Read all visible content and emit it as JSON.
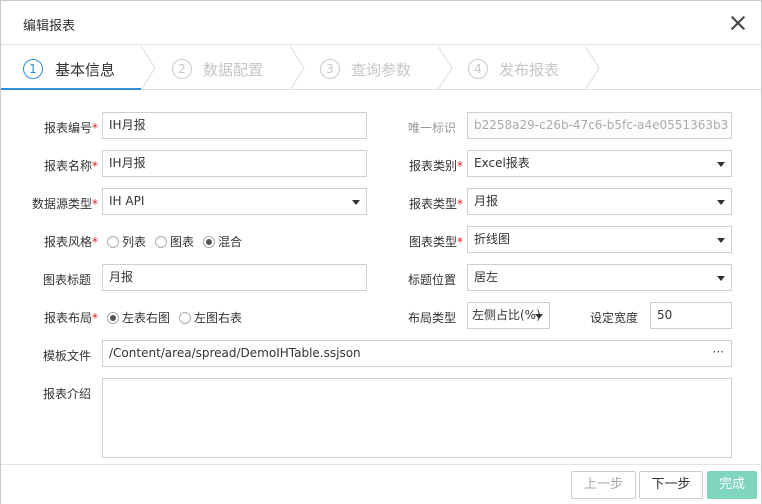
{
  "dialog": {
    "title": "编辑报表"
  },
  "steps": [
    {
      "num": "1",
      "label": "基本信息"
    },
    {
      "num": "2",
      "label": "数据配置"
    },
    {
      "num": "3",
      "label": "查询参数"
    },
    {
      "num": "4",
      "label": "发布报表"
    }
  ],
  "form": {
    "report_code": {
      "label": "报表编号",
      "value": "IH月报"
    },
    "unique_id": {
      "label": "唯一标识",
      "value": "b2258a29-c26b-47c6-b5fc-a4e0551363b3"
    },
    "report_name": {
      "label": "报表名称",
      "value": "IH月报"
    },
    "report_category": {
      "label": "报表类别",
      "value": "Excel报表"
    },
    "datasource_type": {
      "label": "数据源类型",
      "value": "IH API"
    },
    "report_type": {
      "label": "报表类型",
      "value": "月报"
    },
    "report_style": {
      "label": "报表风格",
      "options": [
        "列表",
        "图表",
        "混合"
      ],
      "selected": "混合"
    },
    "chart_type": {
      "label": "图表类型",
      "value": "折线图"
    },
    "chart_title": {
      "label": "图表标题",
      "value": "月报"
    },
    "title_position": {
      "label": "标题位置",
      "value": "居左"
    },
    "report_layout": {
      "label": "报表布局",
      "options": [
        "左表右图",
        "左图右表"
      ],
      "selected": "左表右图"
    },
    "layout_type": {
      "label": "布局类型",
      "value": "左侧占比(%)"
    },
    "set_width": {
      "label": "设定宽度",
      "value": "50"
    },
    "template_file": {
      "label": "模板文件",
      "value": "/Content/area/spread/DemoIHTable.ssjson",
      "browse": "···"
    },
    "report_intro": {
      "label": "报表介绍",
      "value": ""
    },
    "required_mark": "*"
  },
  "footer": {
    "prev": "上一步",
    "next": "下一步",
    "finish": "完成"
  },
  "colors": {
    "accent": "#2e8ed6",
    "finish": "#7fd5bd",
    "required": "#e02020"
  }
}
